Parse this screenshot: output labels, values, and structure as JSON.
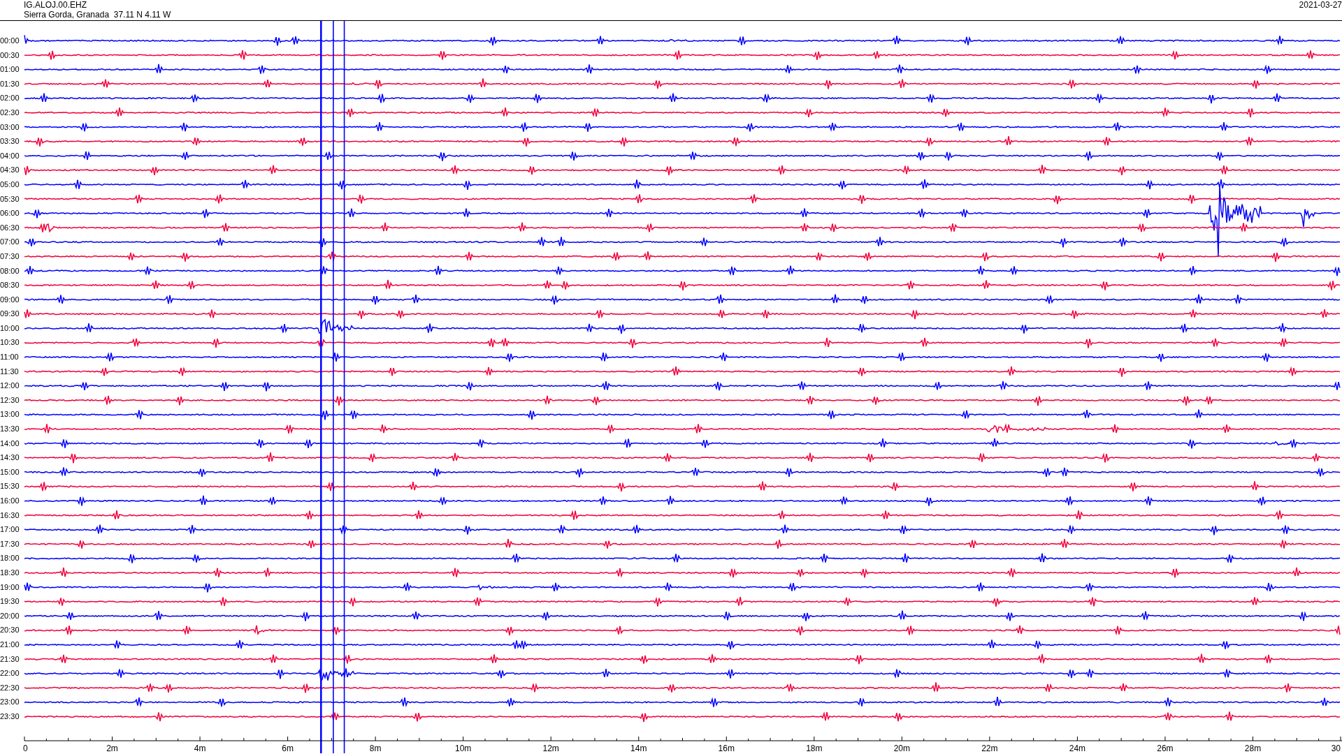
{
  "header": {
    "station": "IG.ALOJ.00.EHZ",
    "location": "Sierra Gorda, Granada  37.11 N 4.11 W",
    "date": "2021-03-27"
  },
  "rows": [
    {
      "label": "00:00",
      "color": "#0000ff"
    },
    {
      "label": "00:30",
      "color": "#f2003c"
    },
    {
      "label": "01:00",
      "color": "#0000ff"
    },
    {
      "label": "01:30",
      "color": "#f2003c"
    },
    {
      "label": "02:00",
      "color": "#0000ff"
    },
    {
      "label": "02:30",
      "color": "#f2003c"
    },
    {
      "label": "03:00",
      "color": "#0000ff"
    },
    {
      "label": "03:30",
      "color": "#f2003c"
    },
    {
      "label": "04:00",
      "color": "#0000ff"
    },
    {
      "label": "04:30",
      "color": "#f2003c"
    },
    {
      "label": "05:00",
      "color": "#0000ff"
    },
    {
      "label": "05:30",
      "color": "#f2003c"
    },
    {
      "label": "06:00",
      "color": "#0000ff"
    },
    {
      "label": "06:30",
      "color": "#f2003c"
    },
    {
      "label": "07:00",
      "color": "#0000ff"
    },
    {
      "label": "07:30",
      "color": "#f2003c"
    },
    {
      "label": "08:00",
      "color": "#0000ff"
    },
    {
      "label": "08:30",
      "color": "#f2003c"
    },
    {
      "label": "09:00",
      "color": "#0000ff"
    },
    {
      "label": "09:30",
      "color": "#f2003c"
    },
    {
      "label": "10:00",
      "color": "#0000ff"
    },
    {
      "label": "10:30",
      "color": "#f2003c"
    },
    {
      "label": "11:00",
      "color": "#0000ff"
    },
    {
      "label": "11:30",
      "color": "#f2003c"
    },
    {
      "label": "12:00",
      "color": "#0000ff"
    },
    {
      "label": "12:30",
      "color": "#f2003c"
    },
    {
      "label": "13:00",
      "color": "#0000ff"
    },
    {
      "label": "13:30",
      "color": "#f2003c"
    },
    {
      "label": "14:00",
      "color": "#0000ff"
    },
    {
      "label": "14:30",
      "color": "#f2003c"
    },
    {
      "label": "15:00",
      "color": "#0000ff"
    },
    {
      "label": "15:30",
      "color": "#f2003c"
    },
    {
      "label": "16:00",
      "color": "#0000ff"
    },
    {
      "label": "16:30",
      "color": "#f2003c"
    },
    {
      "label": "17:00",
      "color": "#0000ff"
    },
    {
      "label": "17:30",
      "color": "#f2003c"
    },
    {
      "label": "18:00",
      "color": "#0000ff"
    },
    {
      "label": "18:30",
      "color": "#f2003c"
    },
    {
      "label": "19:00",
      "color": "#0000ff"
    },
    {
      "label": "19:30",
      "color": "#f2003c"
    },
    {
      "label": "20:00",
      "color": "#0000ff"
    },
    {
      "label": "20:30",
      "color": "#f2003c"
    },
    {
      "label": "21:00",
      "color": "#0000ff"
    },
    {
      "label": "21:30",
      "color": "#f2003c"
    },
    {
      "label": "22:00",
      "color": "#0000ff"
    },
    {
      "label": "22:30",
      "color": "#f2003c"
    },
    {
      "label": "23:00",
      "color": "#0000ff"
    },
    {
      "label": "23:30",
      "color": "#f2003c"
    }
  ],
  "x_axis": {
    "labels": [
      "0",
      "2m",
      "4m",
      "6m",
      "8m",
      "10m",
      "12m",
      "14m",
      "16m",
      "18m",
      "20m",
      "22m",
      "24m",
      "26m",
      "28m",
      "30"
    ]
  }
}
